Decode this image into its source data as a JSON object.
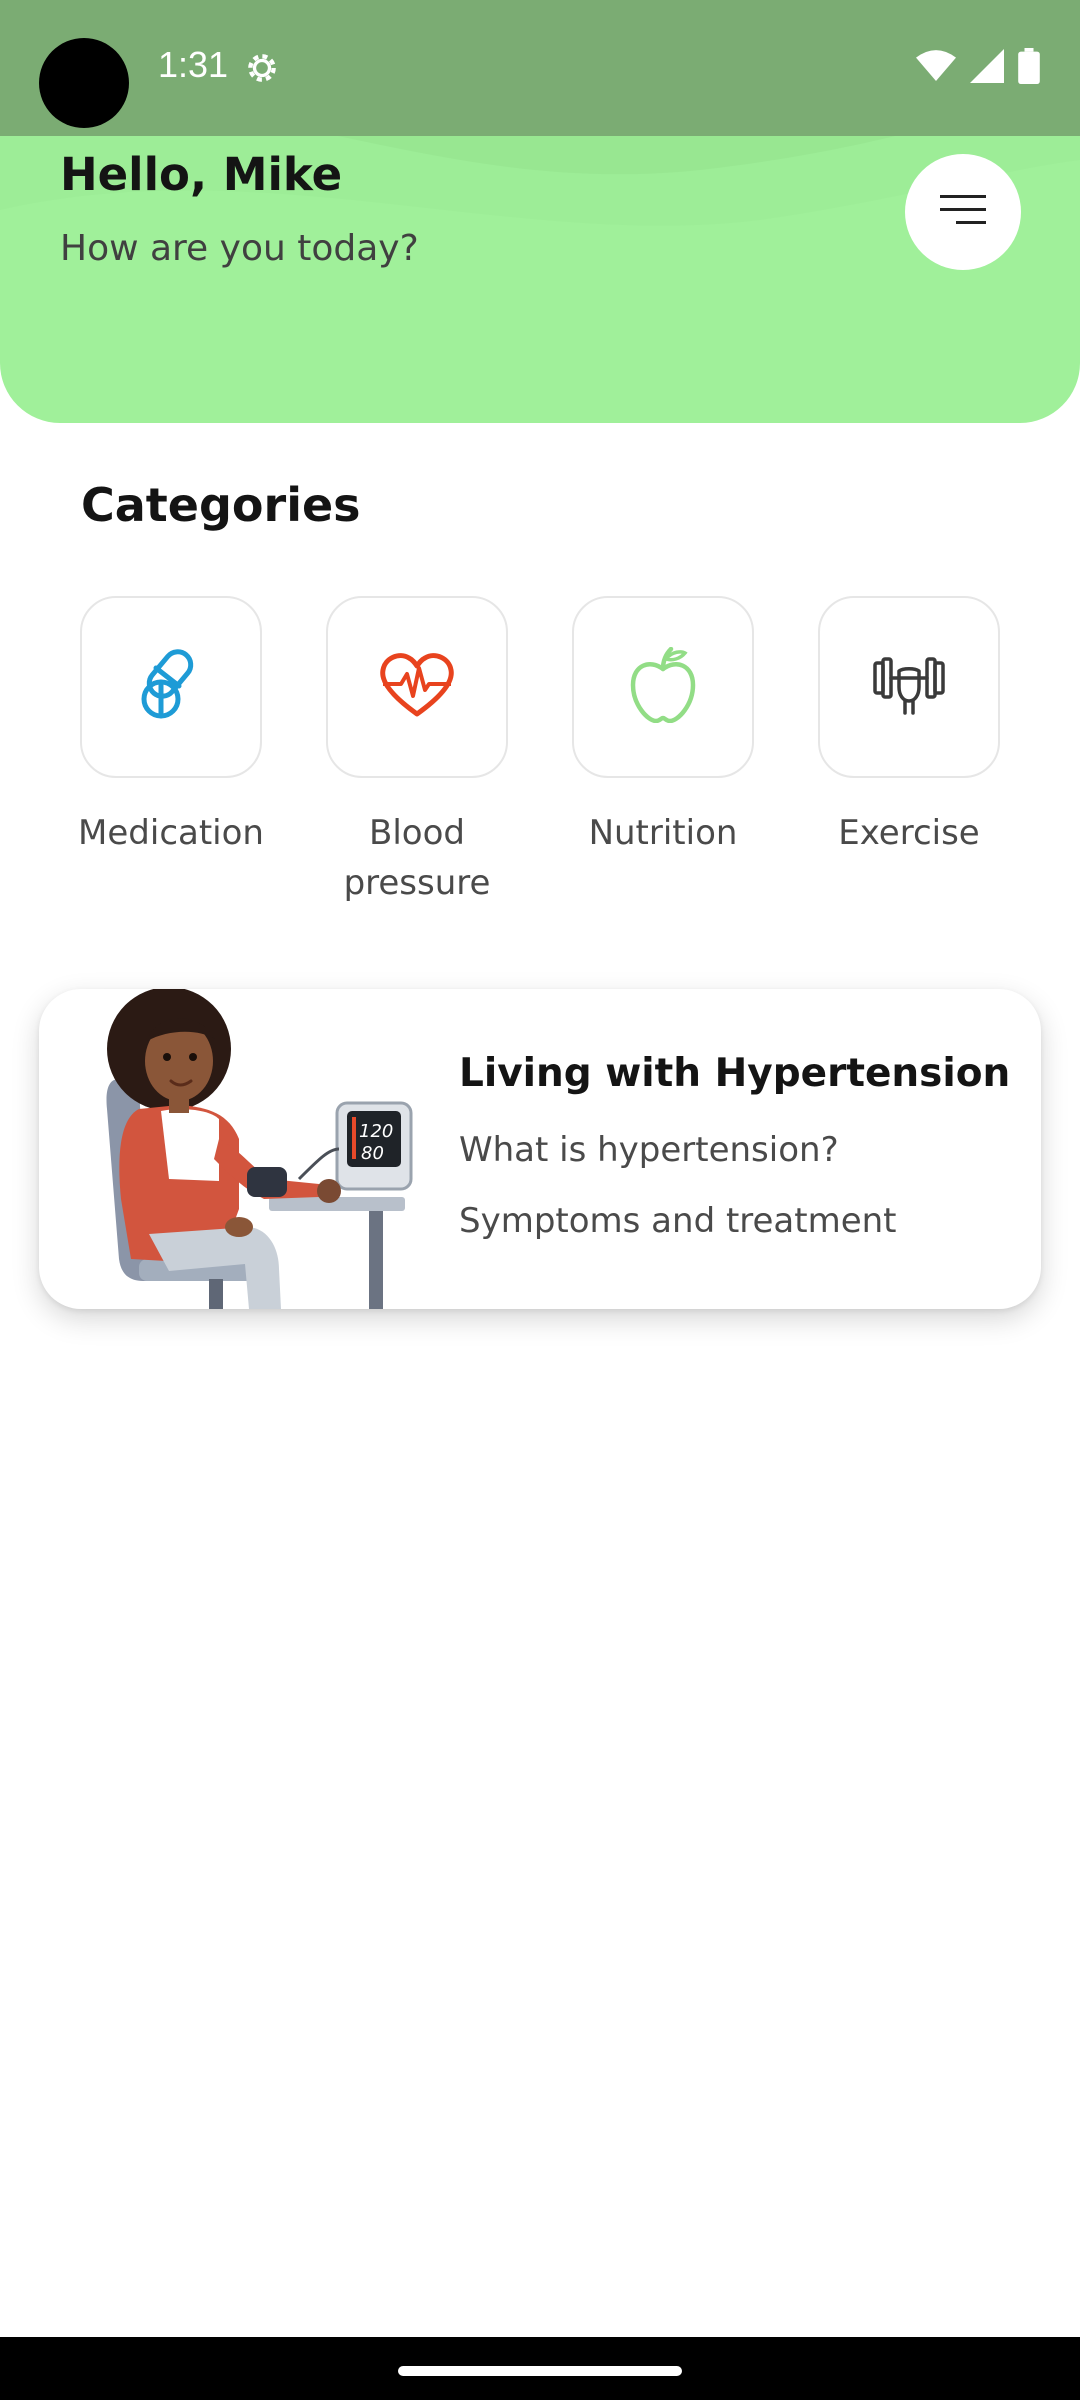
{
  "status_bar": {
    "time": "1:31",
    "icons": [
      "settings-gear-icon",
      "wifi-icon",
      "cellular-signal-icon",
      "battery-icon"
    ]
  },
  "header": {
    "greeting": "Hello, Mike",
    "subtitle": "How are you today?",
    "menu_icon": "menu-icon",
    "background_color": "#a0f09a"
  },
  "categories": {
    "title": "Categories",
    "items": [
      {
        "label": "Medication",
        "icon": "pill-icon",
        "color": "#1e9bd6"
      },
      {
        "label": "Blood pressure",
        "icon": "heart-pulse-icon",
        "color": "#e8431e"
      },
      {
        "label": "Nutrition",
        "icon": "apple-icon",
        "color": "#92dd86"
      },
      {
        "label": "Exercise",
        "icon": "dumbbell-icon",
        "color": "#3a3a3a"
      }
    ]
  },
  "article": {
    "title": "Living with Hypertension",
    "items": [
      "What is hypertension?",
      "Symptoms and treatment"
    ],
    "illustration": "woman-measuring-blood-pressure-illustration",
    "monitor_readings": [
      "120",
      "80"
    ]
  },
  "colors": {
    "accent_green": "#a0f09a",
    "status_bar": "#7bac73"
  }
}
